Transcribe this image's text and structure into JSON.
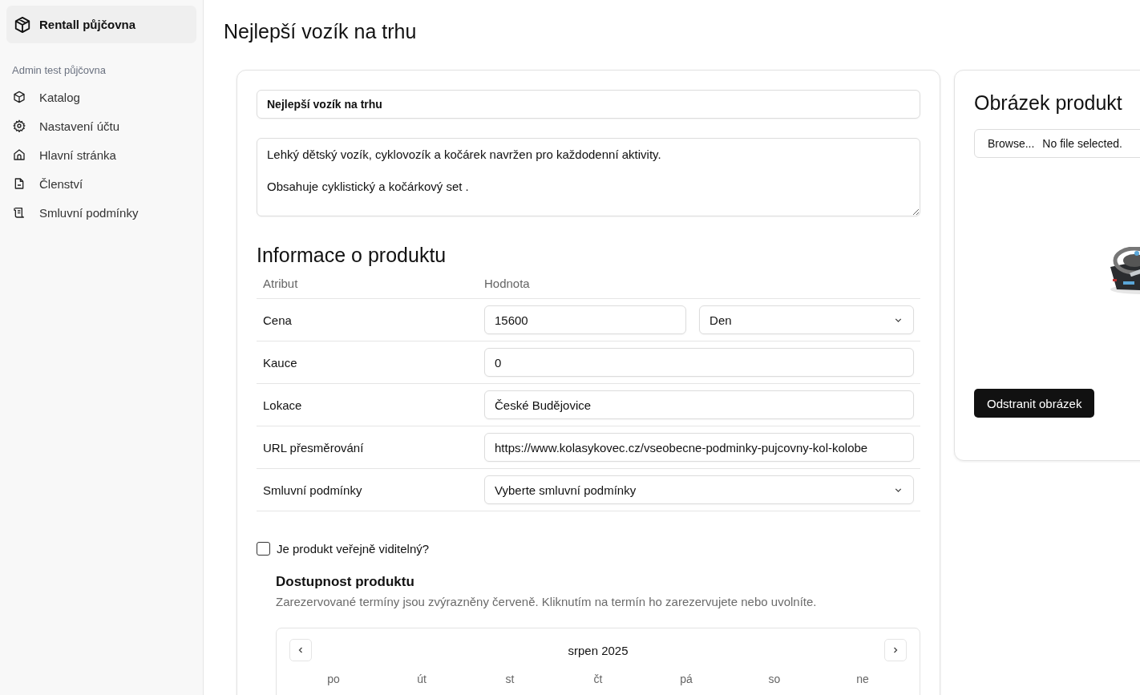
{
  "sidebar": {
    "brand": "Rentall půjčovna",
    "section": "Admin test půjčovna",
    "items": [
      {
        "label": "Katalog"
      },
      {
        "label": "Nastavení účtu"
      },
      {
        "label": "Hlavní stránka"
      },
      {
        "label": "Členství"
      },
      {
        "label": "Smluvní podmínky"
      }
    ]
  },
  "page_title": "Nejlepší vozík na trhu",
  "product": {
    "name": "Nejlepší vozík na trhu",
    "description": "Lehký dětský vozík, cyklovozík a kočárek navržen pro každodenní aktivity.\n\nObsahuje cyklistický a kočárkový set ."
  },
  "info": {
    "title": "Informace o produktu",
    "columns": [
      "Atribut",
      "Hodnota"
    ],
    "rows": [
      {
        "label": "Cena",
        "kind": "price",
        "value": "15600",
        "unit": "Den"
      },
      {
        "label": "Kauce",
        "kind": "text",
        "value": "0"
      },
      {
        "label": "Lokace",
        "kind": "text",
        "value": "České Budějovice"
      },
      {
        "label": "URL přesměrování",
        "kind": "text",
        "value": "https://www.kolasykovec.cz/vseobecne-podminky-pujcovny-kol-kolobe"
      },
      {
        "label": "Smluvní podmínky",
        "kind": "select",
        "value": "Vyberte smluvní podmínky"
      }
    ]
  },
  "public": {
    "label": "Je produkt veřejně viditelný?",
    "checked": false
  },
  "availability": {
    "title": "Dostupnost produktu",
    "description": "Zarezervované termíny jsou zvýrazněny červeně. Kliknutím na termín ho zarezervujete nebo uvolníte.",
    "month": "srpen 2025",
    "weekdays": [
      "po",
      "út",
      "st",
      "čt",
      "pá",
      "so",
      "ne"
    ]
  },
  "image_panel": {
    "title": "Obrázek produkt",
    "browse": "Browse...",
    "file_status": "No file selected.",
    "remove": "Odstranit obrázek"
  }
}
